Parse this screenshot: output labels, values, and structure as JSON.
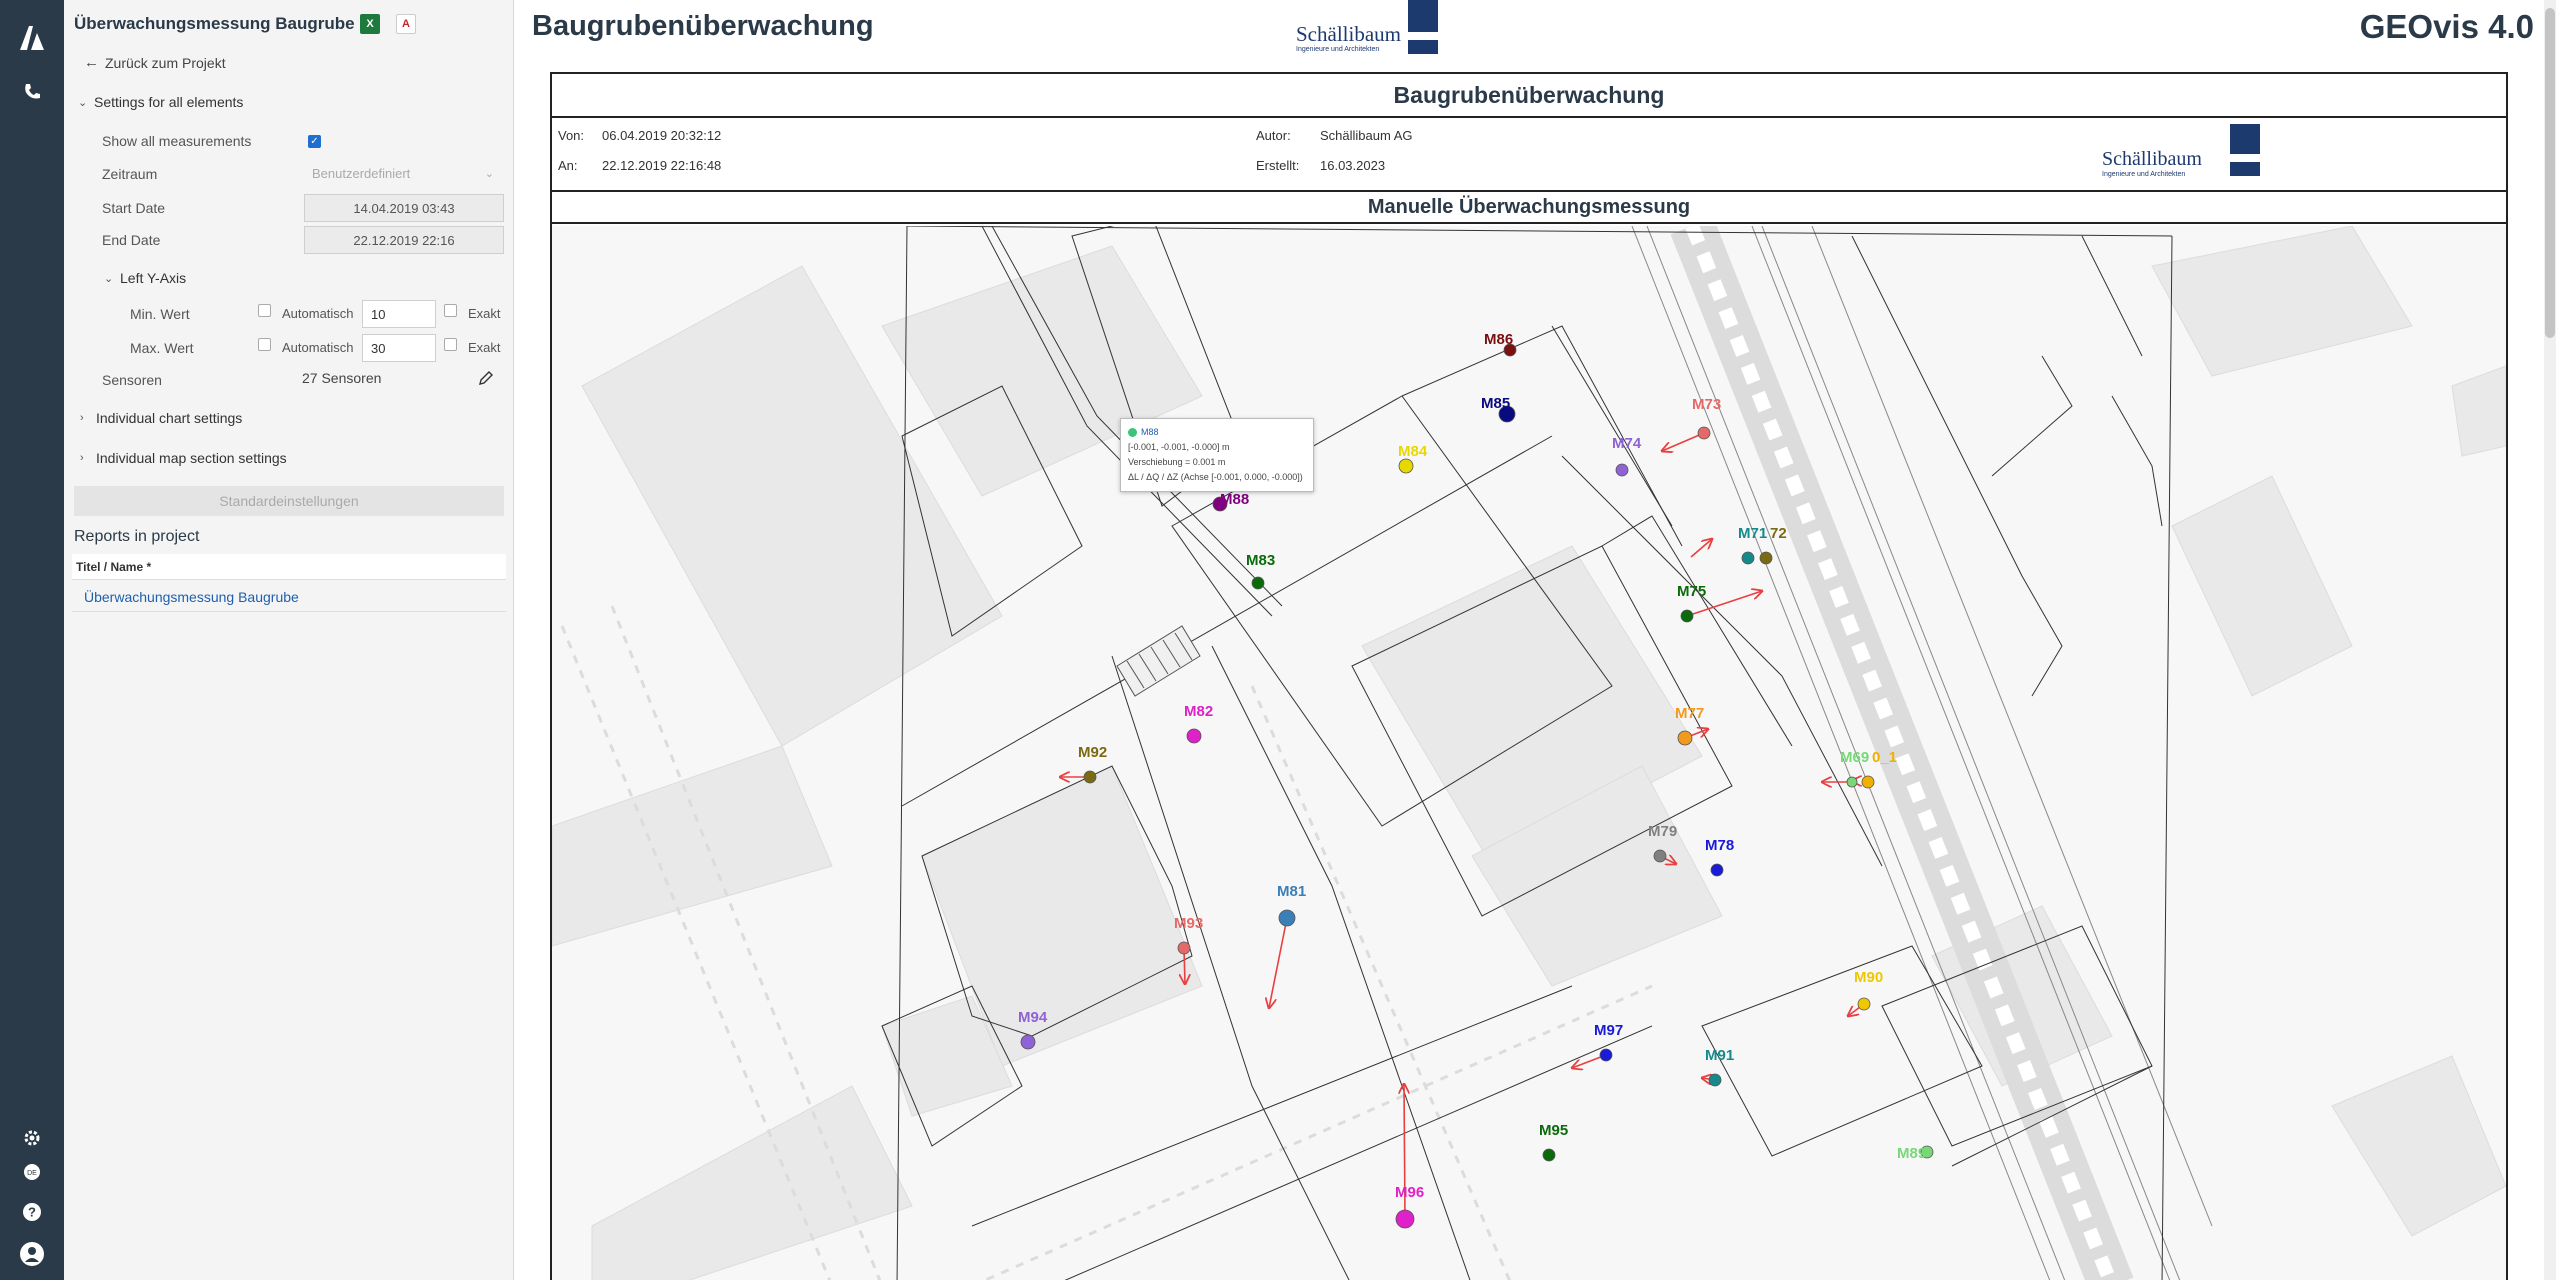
{
  "header": {
    "title": "Baugrubenüberwachung",
    "product": "GEOvis 4.0"
  },
  "logo": {
    "name": "Schällibaum",
    "tagline": "Ingenieure und Architekten"
  },
  "rail": {
    "icons": [
      "app-logo-icon",
      "phone-icon",
      "settings-icon",
      "language-icon",
      "help-icon",
      "user-icon"
    ]
  },
  "panel": {
    "title": "Überwachungsmessung Baugrube",
    "back_label": "Zurück zum Projekt",
    "settings_section": "Settings for all elements",
    "show_all_label": "Show all measurements",
    "zeitraum_label": "Zeitraum",
    "zeitraum_value": "Benutzerdefiniert",
    "start_label": "Start Date",
    "start_value": "14.04.2019 03:43",
    "end_label": "End Date",
    "end_value": "22.12.2019 22:16",
    "left_axis_label": "Left Y-Axis",
    "min_label": "Min. Wert",
    "max_label": "Max. Wert",
    "auto_label": "Automatisch",
    "exact_label": "Exakt",
    "min_value": "10",
    "max_value": "30",
    "sensors_label": "Sensoren",
    "sensors_value": "27 Sensoren",
    "chart_settings": "Individual chart settings",
    "map_settings": "Individual map section settings",
    "defaults_button": "Standardeinstellungen",
    "reports_heading": "Reports in project",
    "reports_col": "Titel / Name *",
    "report_item": "Überwachungsmessung Baugrube"
  },
  "report": {
    "title": "Baugrubenüberwachung",
    "von_label": "Von:",
    "von_value": "06.04.2019 20:32:12",
    "an_label": "An:",
    "an_value": "22.12.2019 22:16:48",
    "autor_label": "Autor:",
    "autor_value": "Schällibaum AG",
    "erstellt_label": "Erstellt:",
    "erstellt_value": "16.03.2023",
    "subtitle": "Manuelle Überwachungsmessung"
  },
  "tooltip": {
    "sensor": "M88",
    "line1": "[-0.001, -0.001, -0.000] m",
    "line2": "Verschiebung = 0.001 m",
    "line3": "ΔL / ΔQ / ΔZ (Achse [-0.001, 0.000, -0.000])"
  },
  "sensors": [
    {
      "name": "M86",
      "color": "#7a1010"
    },
    {
      "name": "M85",
      "color": "#0a0a80"
    },
    {
      "name": "M84",
      "color": "#e8d800"
    },
    {
      "name": "M88",
      "color": "#800080"
    },
    {
      "name": "M83",
      "color": "#0b6b0b"
    },
    {
      "name": "M74",
      "color": "#8f62d6"
    },
    {
      "name": "M73",
      "color": "#e46a6a"
    },
    {
      "name": "M71",
      "color": "#168a8a"
    },
    {
      "name": "72",
      "color": "#7a6a12"
    },
    {
      "name": "M75",
      "color": "#0b6b0b"
    },
    {
      "name": "M77",
      "color": "#f09a20"
    },
    {
      "name": "M82",
      "color": "#e020c8"
    },
    {
      "name": "M92",
      "color": "#7a6a12"
    },
    {
      "name": "M69",
      "color": "#78d878"
    },
    {
      "name": "0_1",
      "color": "#f0b000"
    },
    {
      "name": "M79",
      "color": "#808080"
    },
    {
      "name": "M78",
      "color": "#1a1ad8"
    },
    {
      "name": "M81",
      "color": "#3b7fb8"
    },
    {
      "name": "M93",
      "color": "#e46a6a"
    },
    {
      "name": "M94",
      "color": "#8f62d6"
    },
    {
      "name": "M97",
      "color": "#1a1ad8"
    },
    {
      "name": "M90",
      "color": "#f0c800"
    },
    {
      "name": "M91",
      "color": "#168a8a"
    },
    {
      "name": "M95",
      "color": "#0b6b0b"
    },
    {
      "name": "M89",
      "color": "#78d878"
    },
    {
      "name": "M96",
      "color": "#e020c8"
    }
  ]
}
